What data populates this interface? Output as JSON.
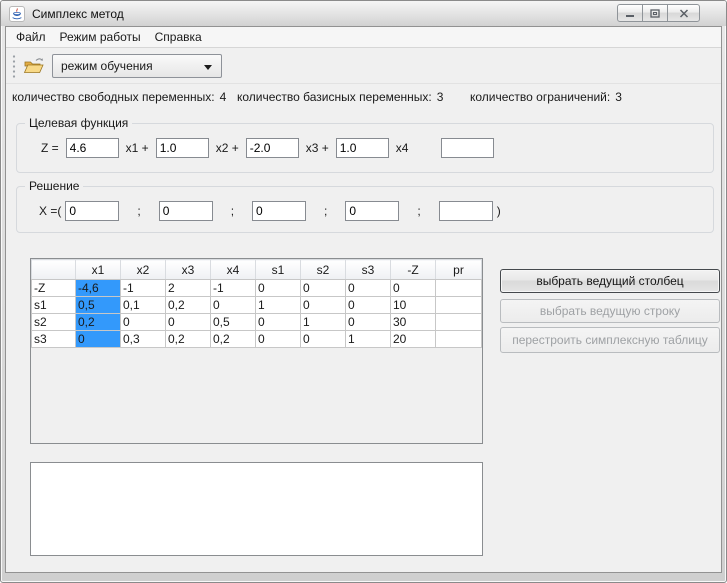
{
  "colors": {
    "highlight": "#3399fb",
    "window_bg": "#f0f0f0"
  },
  "window": {
    "title": "Симплекс метод",
    "app_icon": "java-coffee-cup-icon",
    "controls": [
      {
        "name": "minimize"
      },
      {
        "name": "maximize"
      },
      {
        "name": "close"
      }
    ]
  },
  "menu": {
    "items": [
      {
        "label": "Файл"
      },
      {
        "label": "Режим работы"
      },
      {
        "label": "Справка"
      }
    ]
  },
  "toolbar": {
    "open_button_icon": "open-folder-icon",
    "mode_dropdown": {
      "value": "режим обучения"
    }
  },
  "params": [
    {
      "label": "количество свободных переменных:",
      "value": "4"
    },
    {
      "label": "количество базисных переменных:",
      "value": "3"
    },
    {
      "label": "количество ограничений:",
      "value": "3"
    }
  ],
  "objective": {
    "title": "Целевая функция",
    "prefix": "Z =",
    "terms": [
      {
        "coef": "4.6",
        "var_label": "x1 +"
      },
      {
        "coef": "1.0",
        "var_label": "x2 +"
      },
      {
        "coef": "-2.0",
        "var_label": "x3 +"
      },
      {
        "coef": "1.0",
        "var_label": "x4"
      }
    ],
    "extra_field_value": ""
  },
  "solution": {
    "title": "Решение",
    "prefix": "X =(",
    "separator": ";",
    "suffix": ")",
    "values": [
      "0",
      "0",
      "0",
      "0",
      ""
    ]
  },
  "table": {
    "headers": [
      "",
      "x1",
      "x2",
      "x3",
      "x4",
      "s1",
      "s2",
      "s3",
      "-Z",
      "pr"
    ],
    "highlighted_column": "x1",
    "rows": [
      {
        "name": "-Z",
        "cells": [
          "-4,6",
          "-1",
          "2",
          "-1",
          "0",
          "0",
          "0",
          "0",
          ""
        ]
      },
      {
        "name": "s1",
        "cells": [
          "0,5",
          "0,1",
          "0,2",
          "0",
          "1",
          "0",
          "0",
          "10",
          ""
        ]
      },
      {
        "name": "s2",
        "cells": [
          "0,2",
          "0",
          "0",
          "0,5",
          "0",
          "1",
          "0",
          "30",
          ""
        ]
      },
      {
        "name": "s3",
        "cells": [
          "0",
          "0,3",
          "0,2",
          "0,2",
          "0",
          "0",
          "1",
          "20",
          ""
        ]
      }
    ]
  },
  "actions": {
    "buttons": [
      {
        "label": "выбрать ведущий столбец",
        "enabled": true
      },
      {
        "label": "выбрать ведущую строку",
        "enabled": false
      },
      {
        "label": "перестроить симплексную таблицу",
        "enabled": false
      }
    ]
  },
  "log": {
    "value": ""
  }
}
